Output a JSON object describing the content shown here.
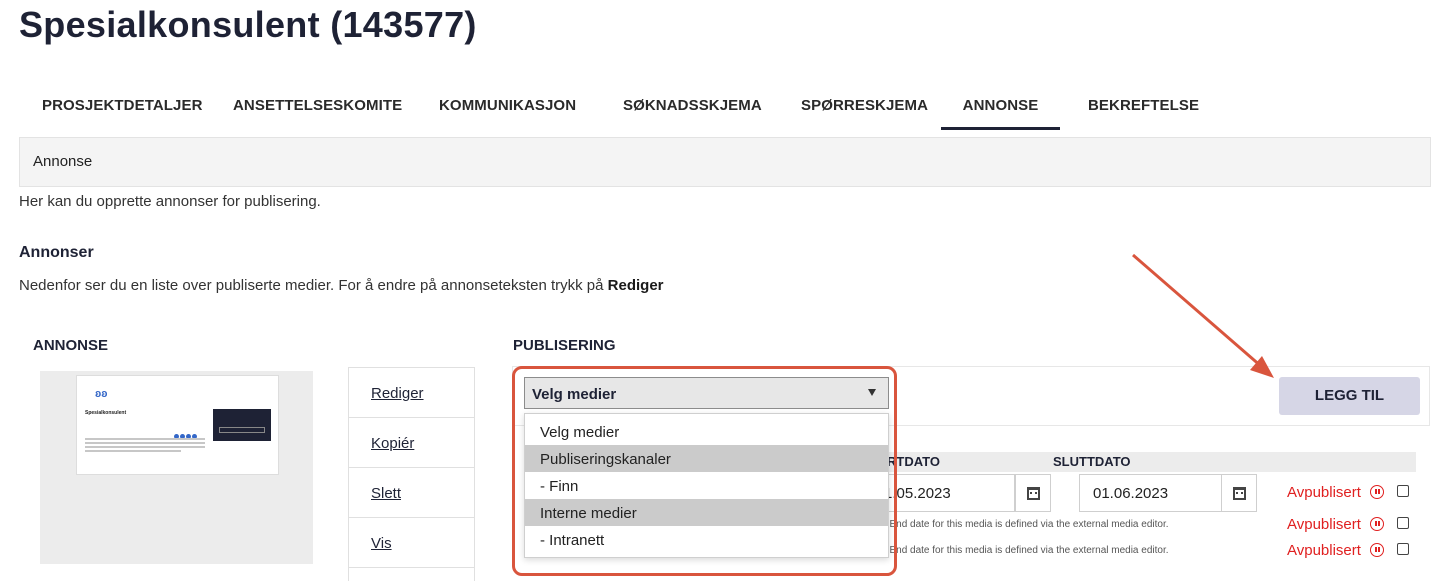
{
  "page": {
    "title": "Spesialkonsulent (143577)"
  },
  "tabs": [
    {
      "label": "PROSJEKTDETALJER"
    },
    {
      "label": "ANSETTELSESKOMITE"
    },
    {
      "label": "KOMMUNIKASJON"
    },
    {
      "label": "SØKNADSSKJEMA"
    },
    {
      "label": "SPØRRESKJEMA"
    },
    {
      "label": "ANNONSE",
      "active": true
    },
    {
      "label": "BEKREFTELSE"
    }
  ],
  "section": {
    "bar_title": "Annonse",
    "intro": "Her kan du opprette annonser for publisering.",
    "heading": "Annonser",
    "desc_text": "Nedenfor ser du en liste over publiserte medier. For å endre på annonseteksten trykk på ",
    "desc_bold": "Rediger"
  },
  "columns": {
    "annonse": "ANNONSE",
    "publisering": "PUBLISERING"
  },
  "preview": {
    "logo": "ʚʚ",
    "heading": "Spesialkonsulent"
  },
  "actions": [
    "Rediger",
    "Kopiér",
    "Slett",
    "Vis"
  ],
  "publish": {
    "select_value": "Velg medier",
    "options": [
      {
        "label": "Velg medier",
        "shaded": false
      },
      {
        "label": "Publiseringskanaler",
        "shaded": true
      },
      {
        "label": "- Finn",
        "shaded": false
      },
      {
        "label": "Interne medier",
        "shaded": true
      },
      {
        "label": "- Intranett",
        "shaded": false
      }
    ],
    "add_button": "LEGG TIL",
    "table_headers": {
      "start": "RTDATO",
      "end": "SLUTTDATO"
    },
    "rows": [
      {
        "start": "1.05.2023",
        "end": "01.06.2023",
        "status": "Avpublisert"
      },
      {
        "note": "and End date for this media is defined via the external media editor.",
        "status": "Avpublisert"
      },
      {
        "note": "and End date for this media is defined via the external media editor.",
        "status": "Avpublisert"
      }
    ]
  },
  "colors": {
    "accent": "#1e2235",
    "highlight_border": "#d9553d",
    "danger": "#e02020",
    "button_bg": "#d6d6e6"
  },
  "icons": [
    "calendar-icon",
    "pause-icon",
    "dropdown-arrow-icon",
    "annotation-arrow"
  ]
}
